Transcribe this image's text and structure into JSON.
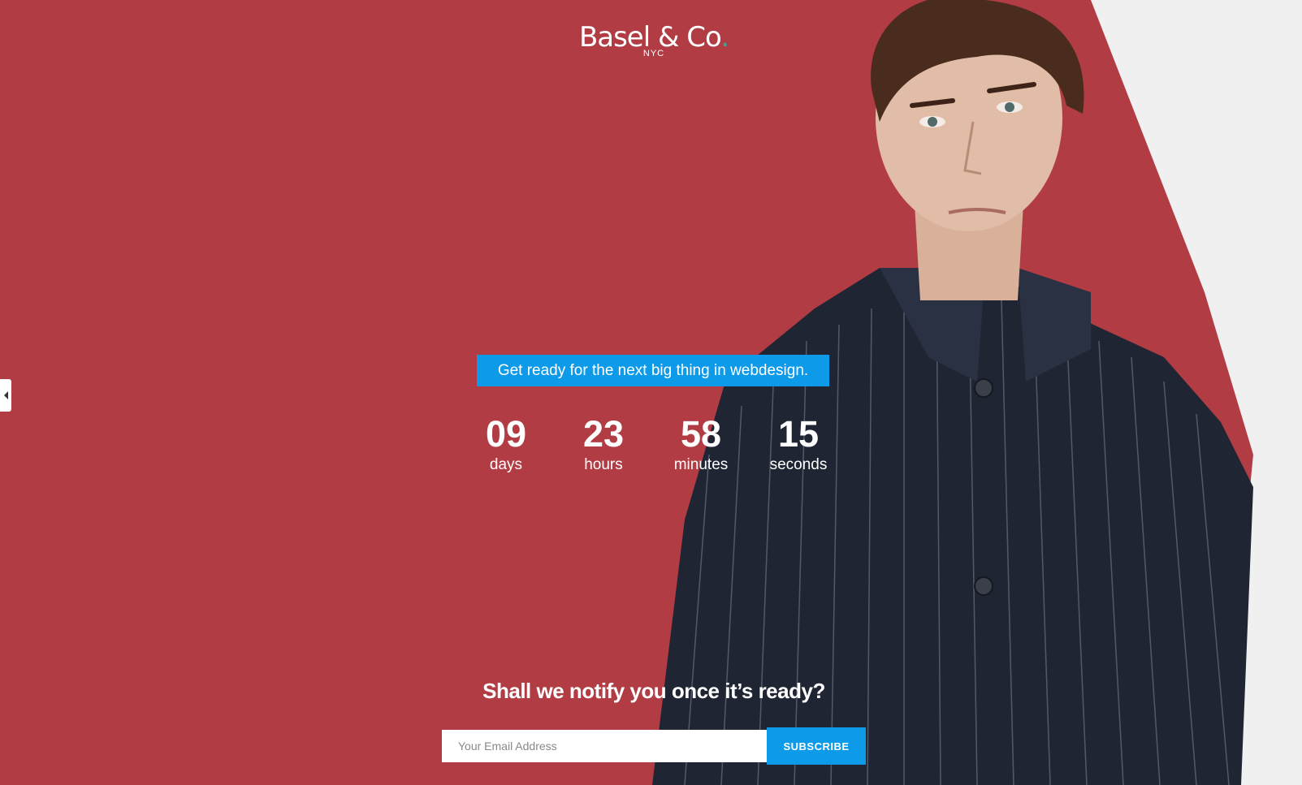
{
  "header": {
    "brand": "Basel & Co",
    "brand_dot": ".",
    "brand_sub": "NYC"
  },
  "hero": {
    "tagline": "Get ready for the next big thing in webdesign."
  },
  "countdown": {
    "days": "09",
    "days_label": "days",
    "hours": "23",
    "hours_label": "hours",
    "minutes": "58",
    "minutes_label": "minutes",
    "seconds": "15",
    "seconds_label": "seconds"
  },
  "notify": {
    "heading": "Shall we notify you once it’s ready?",
    "email_placeholder": "Your Email Address",
    "subscribe_label": "SUBSCRIBE"
  },
  "colors": {
    "background": "#b23c44",
    "accent": "#0d9ae8",
    "logo_dot": "#19b3a6"
  },
  "icons": {
    "side_toggle": "caret-left-icon"
  }
}
